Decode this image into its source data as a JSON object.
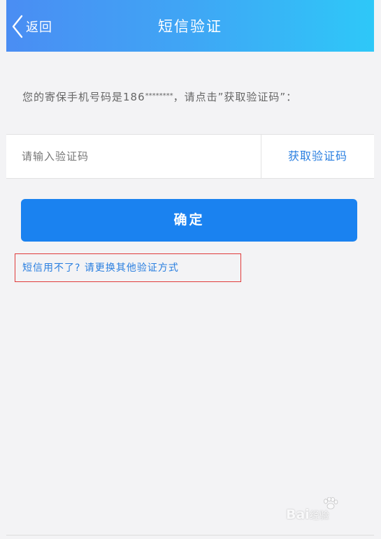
{
  "header": {
    "back_label": "返回",
    "title": "短信验证",
    "gradient_start": "#4a8df3",
    "gradient_end": "#2ec8f8"
  },
  "info": {
    "prefix": "您的寄保手机号码是186",
    "masked": "********",
    "suffix": "，请点击”获取验证码”："
  },
  "code_field": {
    "placeholder": "请输入验证码",
    "value": ""
  },
  "get_code_label": "获取验证码",
  "confirm_label": "确定",
  "alt_link_label": "短信用不了? 请更换其他验证方式",
  "watermark": {
    "brand": "Bai",
    "brand_tail": "经验",
    "domain": "jingyan.baidu.com"
  },
  "colors": {
    "accent": "#1a82f0",
    "link": "#2a7fe0",
    "highlight_border": "#e03a3a",
    "background": "#f3f3f5"
  }
}
